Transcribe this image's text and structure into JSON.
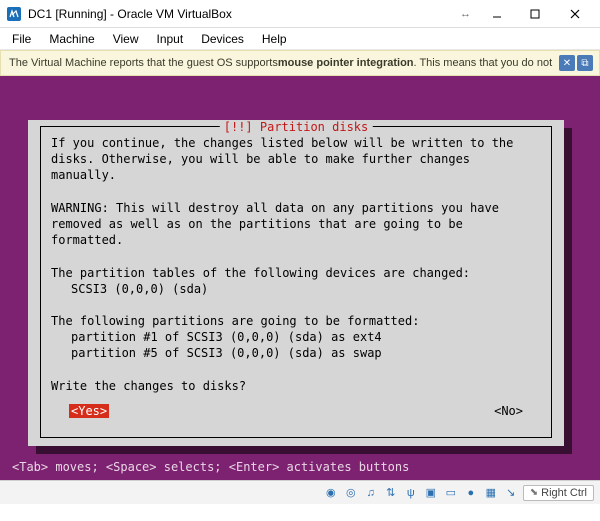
{
  "titlebar": {
    "title": "DC1 [Running] - Oracle VM VirtualBox"
  },
  "menubar": {
    "items": [
      "File",
      "Machine",
      "View",
      "Input",
      "Devices",
      "Help"
    ]
  },
  "info_bar": {
    "prefix": "The Virtual Machine reports that the guest OS supports ",
    "bold": "mouse pointer integration",
    "suffix": ". This means that you do not"
  },
  "installer": {
    "title": "[!!] Partition disks",
    "body1": "If you continue, the changes listed below will be written to the disks. Otherwise, you will be able to make further changes manually.",
    "body2": "WARNING: This will destroy all data on any partitions you have removed as well as on the partitions that are going to be formatted.",
    "body3": "The partition tables of the following devices are changed:",
    "dev1": "SCSI3 (0,0,0) (sda)",
    "body4": "The following partitions are going to be formatted:",
    "part1": "partition #1 of SCSI3 (0,0,0) (sda) as ext4",
    "part2": "partition #5 of SCSI3 (0,0,0) (sda) as swap",
    "prompt": "Write the changes to disks?",
    "yes": "<Yes>",
    "no": "<No>"
  },
  "hint": "<Tab> moves; <Space> selects; <Enter> activates buttons",
  "statusbar": {
    "host_key": "Right Ctrl"
  }
}
